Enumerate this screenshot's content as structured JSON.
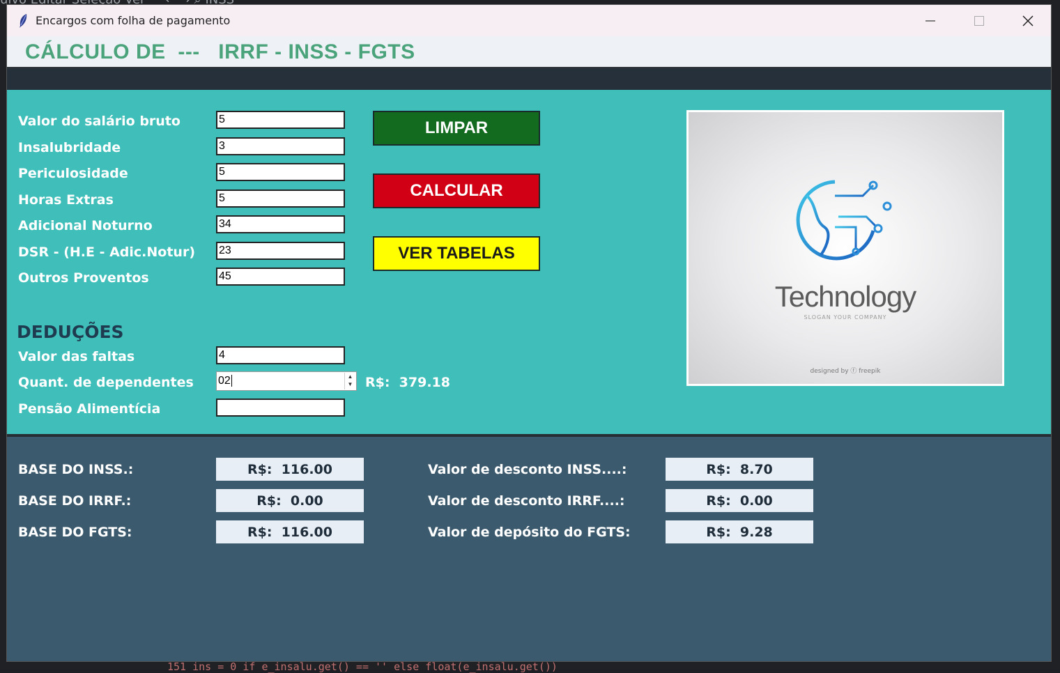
{
  "window": {
    "title": "Encargos com folha de pagamento",
    "minimize_glyph": "—",
    "maximize_glyph": "☐",
    "close_glyph": "✕"
  },
  "header": {
    "title": "CÁLCULO DE  ---   IRRF - INSS - FGTS"
  },
  "proventos": [
    {
      "label": "Valor do salário bruto",
      "value": "5"
    },
    {
      "label": "Insalubridade",
      "value": "3"
    },
    {
      "label": "Periculosidade",
      "value": "5"
    },
    {
      "label": "Horas Extras",
      "value": "5"
    },
    {
      "label": "Adicional Noturno",
      "value": "34"
    },
    {
      "label": "DSR  - (H.E - Adic.Notur)",
      "value": "23"
    },
    {
      "label": "Outros Proventos",
      "value": "45"
    }
  ],
  "buttons": {
    "limpar": "LIMPAR",
    "calcular": "CALCULAR",
    "ver_tabelas": "VER TABELAS"
  },
  "deducoes": {
    "heading": "DEDUÇÕES",
    "faltas_label": "Valor das faltas",
    "faltas_value": "4",
    "dependentes_label": "Quant. de dependentes",
    "dependentes_value": "02",
    "dependentes_result": "R$:  379.18",
    "pensao_label": "Pensão Alimentícia",
    "pensao_value": ""
  },
  "image": {
    "word": "Technology",
    "subtitle": "SLOGAN YOUR COMPANY",
    "credit": "designed by ⓕ freepik"
  },
  "results": {
    "base_inss_label": "BASE DO INSS.:",
    "base_inss_value": "R$:  116.00",
    "base_irrf_label": "BASE DO IRRF.:",
    "base_irrf_value": "R$:  0.00",
    "base_fgts_label": "BASE DO FGTS:",
    "base_fgts_value": "R$:  116.00",
    "desc_inss_label": "Valor de desconto INSS....:",
    "desc_inss_value": "R$:  8.70",
    "desc_irrf_label": "Valor de desconto IRRF....:",
    "desc_irrf_value": "R$:  0.00",
    "dep_fgts_label": "Valor de depósito do FGTS:",
    "dep_fgts_value": "R$:  9.28"
  },
  "background": {
    "menu": "uivo   Editar   Seleção   Ver   ···                         ← →                         ⌕ INSS",
    "code": "151          ins = 0 if e_insalu.get() == '' else float(e_insalu.get())"
  },
  "colors": {
    "teal": "#40bfba",
    "slate": "#3c5a6e",
    "limpar": "#126b1f",
    "calcular": "#d10015",
    "ver_tabelas": "#ffff00",
    "title_green": "#4aa37a"
  }
}
